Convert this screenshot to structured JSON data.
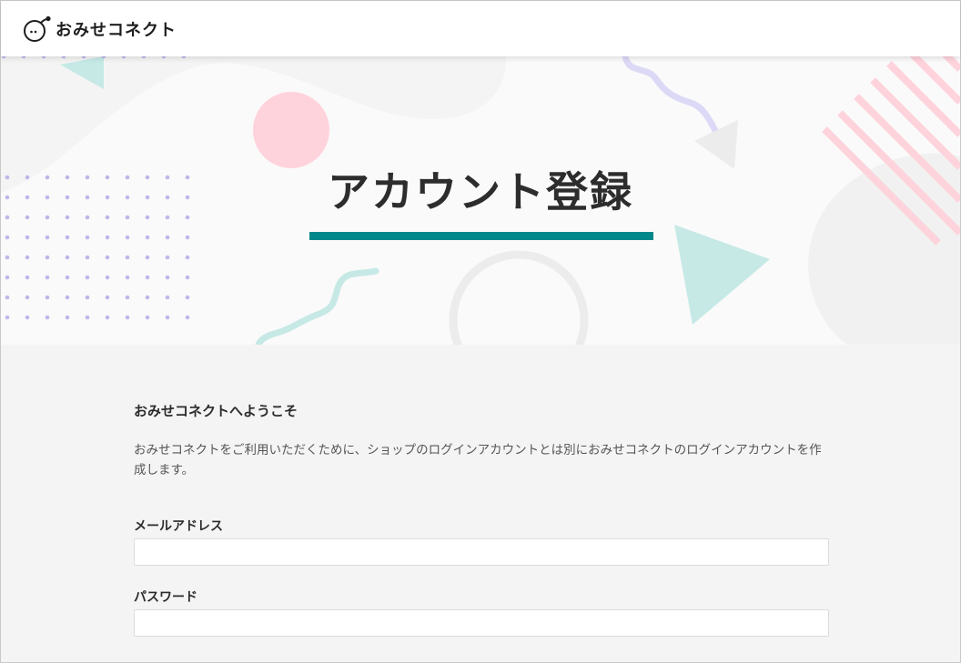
{
  "header": {
    "logo_text": "おみせコネクト"
  },
  "hero": {
    "title": "アカウント登録"
  },
  "main": {
    "welcome_heading": "おみせコネクトへようこそ",
    "description": "おみせコネクトをご利用いただくために、ショップのログインアカウントとは別におみせコネクトのログインアカウントを作成します。",
    "fields": [
      {
        "label": "メールアドレス",
        "value": "",
        "placeholder": ""
      },
      {
        "label": "パスワード",
        "value": "",
        "placeholder": ""
      }
    ]
  },
  "colors": {
    "accent": "#00878a",
    "pink": "#ffd3dc",
    "mint": "#c6e9e6",
    "lavender": "#bdb8ea"
  }
}
